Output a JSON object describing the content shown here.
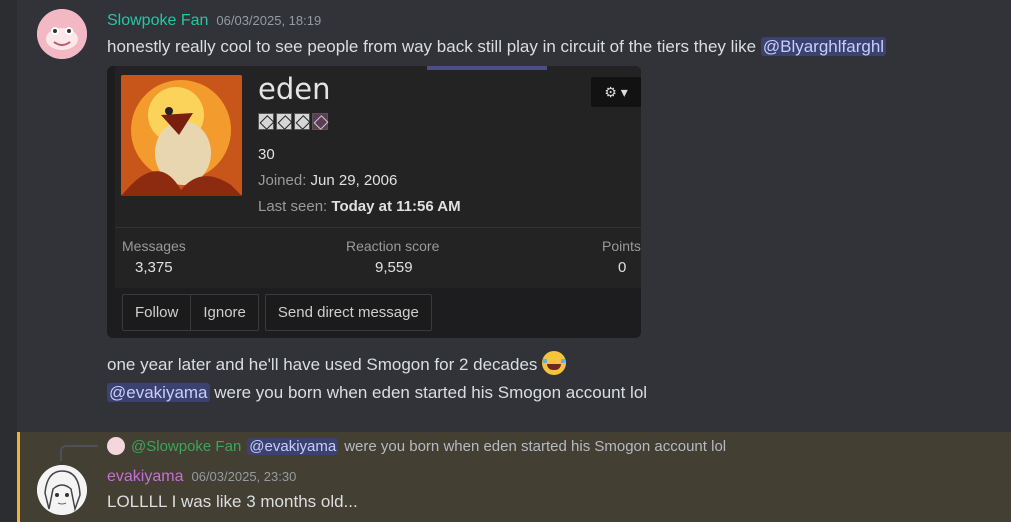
{
  "messages": [
    {
      "author": "Slowpoke Fan",
      "author_color": "#26c6a4",
      "timestamp": "06/03/2025, 18:19",
      "lines": [
        {
          "text": "honestly really cool to see people from way back still play in circuit of the tiers they like ",
          "mention": "@Blyarghlfarghl"
        }
      ]
    }
  ],
  "embed": {
    "username": "eden",
    "messages_count": "30",
    "joined_label": "Joined:",
    "joined_value": "Jun 29, 2006",
    "last_seen_label": "Last seen:",
    "last_seen_value": "Today at 11:56 AM",
    "stats": [
      {
        "label": "Messages",
        "value": "3,375"
      },
      {
        "label": "Reaction score",
        "value": "9,559"
      },
      {
        "label": "Points",
        "value": "0"
      }
    ],
    "buttons": [
      "Follow",
      "Ignore",
      "Send direct message"
    ]
  },
  "followups": {
    "line1": "one year later and he'll have used Smogon for 2 decades",
    "line2_mention": "@evakiyama",
    "line2_text": " were you born when eden started his Smogon account lol"
  },
  "reply_message": {
    "reply_to_author": "@Slowpoke Fan",
    "reply_to_mention": "@evakiyama",
    "reply_to_text": "were you born when eden started his Smogon account lol",
    "author": "evakiyama",
    "author_color": "#c66fd6",
    "timestamp": "06/03/2025, 23:30",
    "text": "LOLLLL I was like 3 months old..."
  },
  "colors": {
    "background": "#313338",
    "mention_bg": "#3c4270",
    "highlight_bg": "#433f33",
    "highlight_bar": "#f0b232"
  }
}
